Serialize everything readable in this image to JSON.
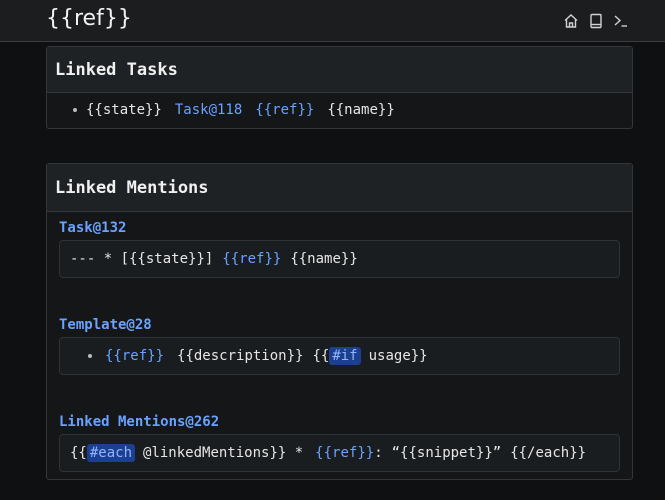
{
  "header": {
    "brand": "{{ref}}",
    "icons": [
      "home-icon",
      "book-icon",
      "terminal-icon"
    ]
  },
  "linked_tasks": {
    "title": "Linked Tasks",
    "item": {
      "state": "{{state}}",
      "task_link": "Task@118",
      "ref": "{{ref}}",
      "name": "{{name}}"
    }
  },
  "linked_mentions": {
    "title": "Linked Mentions",
    "entries": [
      {
        "title": "Task@132",
        "line": {
          "prefix": "--- * [{{state}}]",
          "ref": "{{ref}}",
          "name": "{{name}}"
        }
      },
      {
        "title": "Template@28",
        "line": {
          "ref": "{{ref}}",
          "description": "{{description}}",
          "open": "{{",
          "keyword": "#if",
          "rest": "usage}}"
        }
      },
      {
        "title": "Linked Mentions@262",
        "line": {
          "open": "{{",
          "keyword": "#each",
          "rest": "@linkedMentions}} *",
          "ref": "{{ref}}",
          "colon": ":",
          "snippet": "“{{snippet}}”",
          "close": "{{/each}}"
        }
      }
    ]
  }
}
